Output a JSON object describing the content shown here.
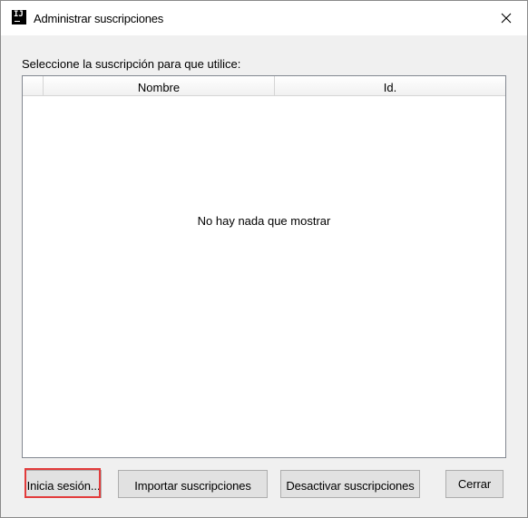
{
  "window": {
    "title": "Administrar suscripciones",
    "icon": "intellij-app-icon",
    "icon_text": "IJ"
  },
  "dialog": {
    "prompt": "Seleccione la suscripción para que utilice:",
    "table": {
      "columns": [
        "",
        "Nombre",
        "Id."
      ],
      "rows": [],
      "empty_message": "No hay nada que mostrar"
    }
  },
  "buttons": {
    "sign_in": "Inicia sesión...",
    "import": "Importar suscripciones",
    "disable": "Desactivar suscripciones",
    "close": "Cerrar"
  },
  "colors": {
    "highlight": "#e23b3b",
    "button_bg": "#e1e1e1",
    "dialog_bg": "#f0f0f0"
  }
}
